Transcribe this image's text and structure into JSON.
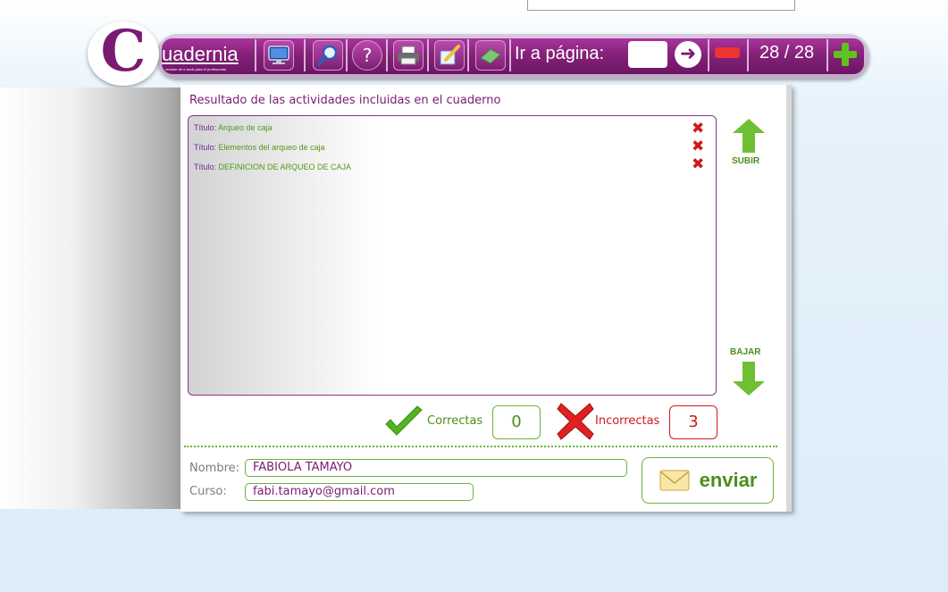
{
  "app": {
    "logo_letter": "C",
    "logo_word": "uadernia",
    "logo_subtitle": "creador de e-book para el profesorado"
  },
  "toolbar": {
    "goto_label": "Ir a página:",
    "goto_value": "",
    "page_indicator": "28 / 28",
    "icons": [
      "monitor-icon",
      "search-icon",
      "help-icon",
      "print-icon",
      "edit-icon",
      "eraser-icon",
      "go-arrow-icon",
      "minus-icon",
      "plus-icon"
    ]
  },
  "results": {
    "title": "Resultado de las actividades incluidas en el cuaderno",
    "items": [
      {
        "label": "Título:",
        "value": "Arqueo de caja",
        "status": "incorrect"
      },
      {
        "label": "Título:",
        "value": "Elementos del arqueo de caja",
        "status": "incorrect"
      },
      {
        "label": "Título:",
        "value": "DEFINICION DE ARQUEO DE CAJA",
        "status": "incorrect"
      }
    ],
    "scroll_up_label": "SUBIR",
    "scroll_down_label": "BAJAR",
    "correct_label": "Correctas",
    "correct_count": "0",
    "incorrect_label": "Incorrectas",
    "incorrect_count": "3"
  },
  "form": {
    "name_label": "Nombre:",
    "name_value": "FABIOLA TAMAYO",
    "course_label": "Curso:",
    "course_value": "fabi.tamayo@gmail.com",
    "send_label": "enviar"
  },
  "colors": {
    "brand_purple": "#7a1b73",
    "accent_green": "#4c8d1a",
    "error_red": "#d21818"
  }
}
